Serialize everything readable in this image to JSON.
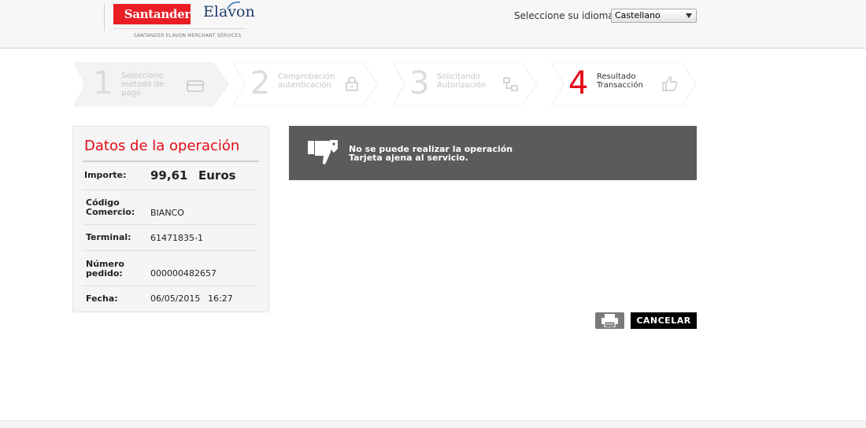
{
  "header": {
    "brand_santander": "Santander",
    "brand_elavon": "Elavon",
    "merchant_services": "SANTANDER ELAVON MERCHANT SERVICES",
    "language_label": "Seleccione su idioma",
    "language_selected": "Castellano"
  },
  "steps": [
    {
      "number": "1",
      "line1": "Seleccione",
      "line2": "método de",
      "line3": "pago",
      "icon": "card-icon",
      "active": false
    },
    {
      "number": "2",
      "line1": "Comprobación",
      "line2": "autenticación",
      "icon": "lock-icon",
      "active": false
    },
    {
      "number": "3",
      "line1": "Solicitando",
      "line2": "Autorización",
      "icon": "network-icon",
      "active": false
    },
    {
      "number": "4",
      "line1": "Resultado",
      "line2": "Transacción",
      "icon": "thumbs-up-icon",
      "active": true
    }
  ],
  "operation": {
    "title": "Datos de la operación",
    "amount_label": "Importe:",
    "amount_value": "99,61",
    "amount_currency": "Euros",
    "merchant_label_1": "Código",
    "merchant_label_2": "Comercio:",
    "merchant_value": "BIANCO",
    "terminal_label": "Terminal:",
    "terminal_value": "61471835-1",
    "order_label_1": "Número",
    "order_label_2": "pedido:",
    "order_value": "000000482657",
    "date_label": "Fecha:",
    "date_value": "06/05/2015",
    "time_value": "16:27"
  },
  "message": {
    "line1": "No se puede realizar la operación",
    "line2": "Tarjeta ajena al servicio.",
    "icon": "thumbs-down-icon"
  },
  "actions": {
    "print_icon": "printer-icon",
    "cancel_label": "CANCELAR"
  },
  "colors": {
    "brand_red": "#e20a17",
    "message_bg": "#5b5b5b",
    "inactive_text": "#c6c6c6"
  }
}
